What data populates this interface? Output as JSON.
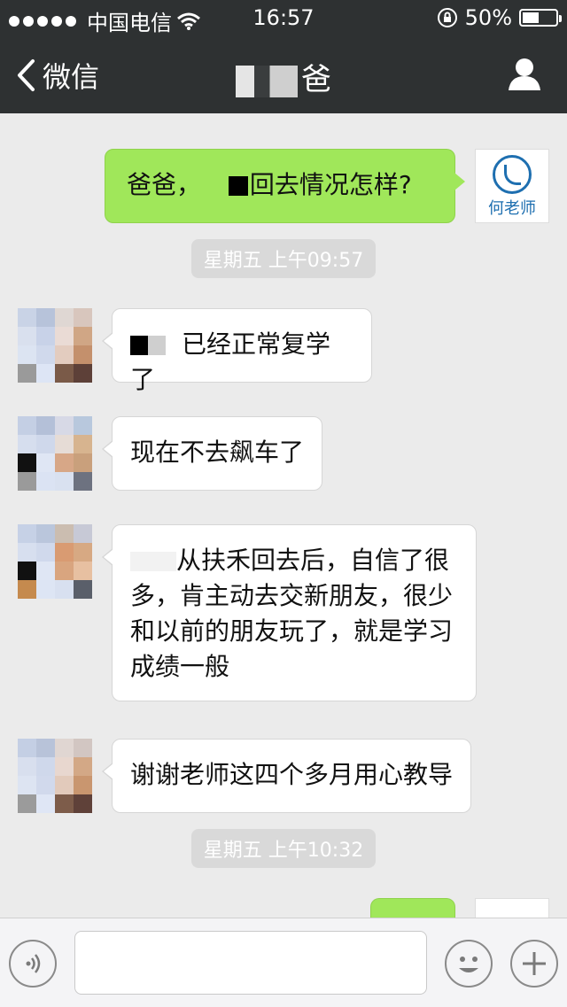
{
  "status_bar": {
    "carrier": "中国电信",
    "time": "16:57",
    "battery": "50%",
    "battery_level": 0.5
  },
  "nav": {
    "back_label": "微信",
    "title": "爸"
  },
  "messages": [
    {
      "from": "me",
      "text": "爸爸，",
      "text2": "回去情况怎样?"
    },
    {
      "type": "timestamp",
      "text": "星期五 上午09:57"
    },
    {
      "from": "other",
      "text": "已经正常复学了"
    },
    {
      "from": "other",
      "text": "现在不去飙车了"
    },
    {
      "from": "other",
      "text": "从扶禾回去后，自信了很多，肯主动去交新朋友，很少和以前的朋友玩了，就是学习成绩一般"
    },
    {
      "from": "other",
      "text": "谢谢老师这四个多月用心教导"
    },
    {
      "type": "timestamp",
      "text": "星期五 上午10:32"
    }
  ],
  "teacher_avatar": {
    "name": "何老师",
    "accent": "#1e6fb0"
  },
  "colors": {
    "bar": "#2e3132",
    "my_bubble": "#a0e75a",
    "background": "#ebebeb"
  },
  "icons": [
    "signal-dots-icon",
    "wifi-icon",
    "rotation-lock-icon",
    "battery-icon",
    "back-chevron-icon",
    "profile-icon",
    "voice-icon",
    "emoji-icon",
    "plus-icon"
  ]
}
